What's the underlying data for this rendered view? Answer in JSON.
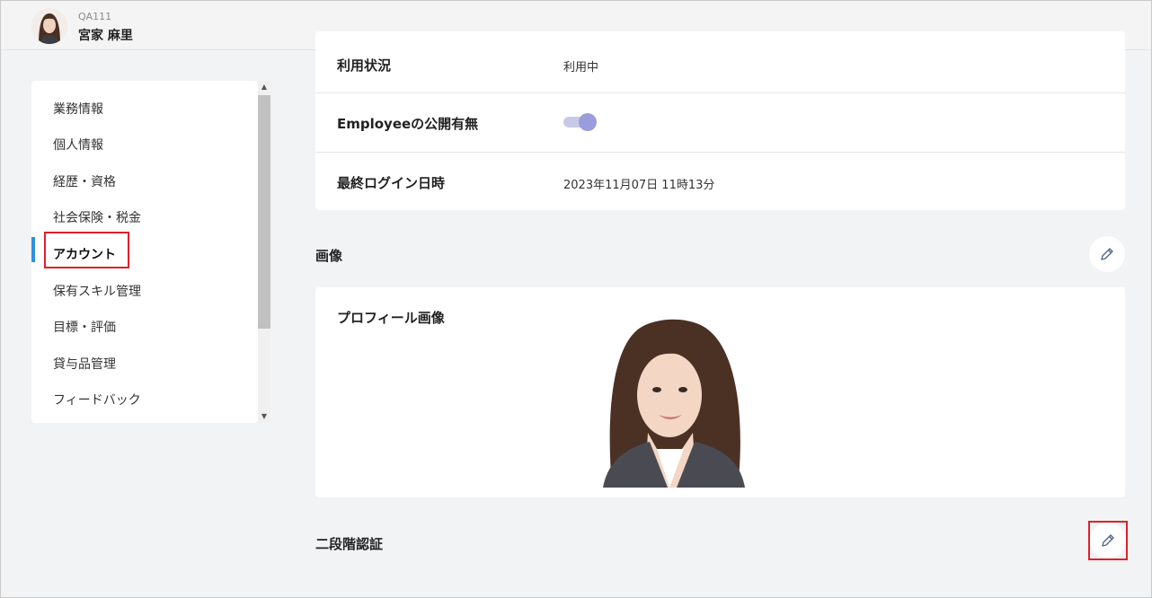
{
  "header": {
    "user_id": "QA111",
    "user_name": "宮家 麻里"
  },
  "sidebar": {
    "items": [
      {
        "label": "業務情報"
      },
      {
        "label": "個人情報"
      },
      {
        "label": "経歴・資格"
      },
      {
        "label": "社会保険・税金"
      },
      {
        "label": "アカウント",
        "active": true
      },
      {
        "label": "保有スキル管理"
      },
      {
        "label": "目標・評価"
      },
      {
        "label": "貸与品管理"
      },
      {
        "label": "フィードバック"
      }
    ]
  },
  "account": {
    "rows": [
      {
        "label": "利用状況",
        "value": "利用中"
      },
      {
        "label": "Employeeの公開有無",
        "toggle_on": true
      },
      {
        "label": "最終ログイン日時",
        "value": "2023年11月07日 11時13分"
      }
    ]
  },
  "image_section": {
    "title": "画像",
    "profile_label": "プロフィール画像"
  },
  "two_factor": {
    "title": "二段階認証"
  },
  "colors": {
    "active_accent": "#2f8fe6",
    "highlight": "#e0202a",
    "toggle": "#9a9ddb"
  },
  "icons": {
    "edit": "pencil-icon"
  }
}
